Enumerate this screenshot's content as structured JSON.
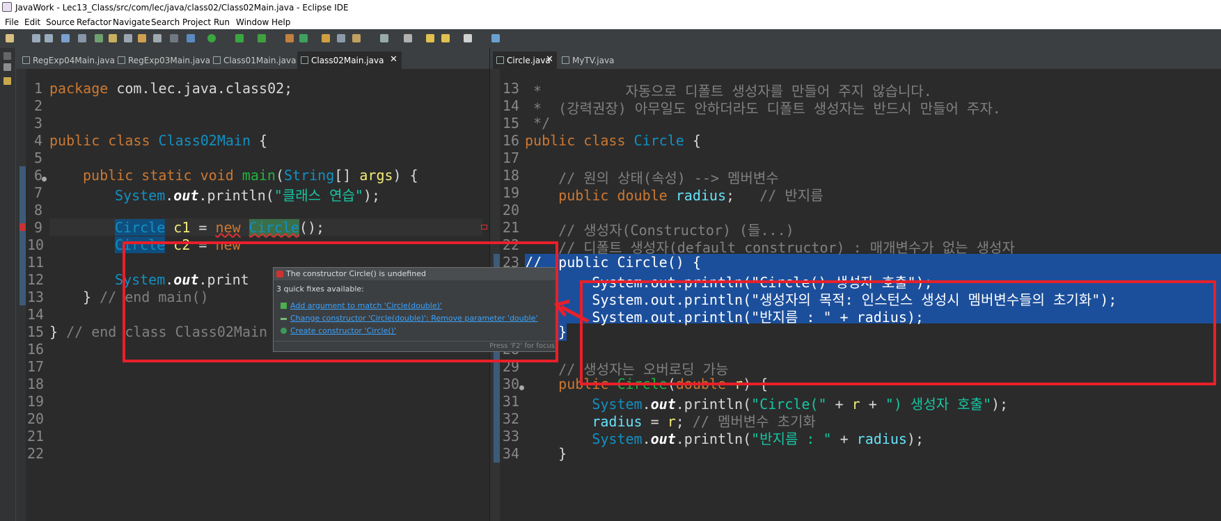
{
  "window": {
    "title": "JavaWork - Lec13_Class/src/com/lec/java/class02/Class02Main.java - Eclipse IDE"
  },
  "menu": [
    "File",
    "Edit",
    "Source",
    "Refactor",
    "Navigate",
    "Search",
    "Project",
    "Run",
    "Window",
    "Help"
  ],
  "left_tabs": [
    "RegExp04Main.java",
    "RegExp03Main.java",
    "Class01Main.java",
    "Class02Main.java"
  ],
  "right_tabs": [
    "Circle.java",
    "MyTV.java"
  ],
  "left_lines": [
    "1",
    "2",
    "3",
    "4",
    "5",
    "6",
    "7",
    "8",
    "9",
    "10",
    "11",
    "12",
    "13",
    "14",
    "15",
    "16",
    "17",
    "18",
    "19",
    "20",
    "21",
    "22"
  ],
  "right_lines": [
    "13",
    "14",
    "15",
    "16",
    "17",
    "18",
    "19",
    "20",
    "21",
    "22",
    "23",
    "24",
    "25",
    "26",
    "27",
    "28",
    "29",
    "30",
    "31",
    "32",
    "33",
    "34"
  ],
  "left_code": {
    "l1_kw": "package",
    "l1_pkg": " com.lec.java.class02;",
    "l4_kw": "public class ",
    "l4_cls": "Class02Main",
    "l4_rest": " {",
    "l6_kw": "public static void ",
    "l6_m": "main",
    "l6_p1": "(",
    "l6_t": "String",
    "l6_p2": "[] ",
    "l6_a": "args",
    "l6_p3": ") {",
    "l7_c": "System",
    "l7_d": ".",
    "l7_o": "out",
    "l7_pr": ".println(",
    "l7_s": "\"클래스 연습\"",
    "l7_e": ");",
    "l9_t": "Circle",
    "l9_v": " c1",
    "l9_eq": " = ",
    "l9_new": "new",
    "l9_sp": " ",
    "l9_c": "Circle",
    "l9_e": "();",
    "l10_t": "Circle",
    "l10_v": " c2",
    "l10_eq": " = ",
    "l10_new": "new",
    "l12_c": "System",
    "l12_d": ".",
    "l12_o": "out",
    "l12_pr": ".print",
    "l13_b": "} ",
    "l13_cm": "// end main()",
    "l15_b": "} ",
    "l15_cm": "// end class Class02Main"
  },
  "right_code": {
    "r13": " *          자동으로 디폴트 생성자를 만들어 주지 않습니다.",
    "r14": " *  (강력권장) 아무일도 안하더라도 디폴트 생성자는 반드시 만들어 주자.",
    "r15": " */",
    "r16_kw": "public class ",
    "r16_cls": "Circle",
    "r16_rest": " {",
    "r18": "    // 원의 상태(속성) --> 멤버변수",
    "r19_kw": "    public double ",
    "r19_f": "radius",
    "r19_e": ";",
    "r19_cm": "   // 반지름",
    "r21": "    // 생성자(Constructor) (들...)",
    "r22": "    // 디폴트 생성자(default constructor) : 매개변수가 없는 생성자",
    "r23": "//  public Circle() {",
    "r24": "//      System.out.println(\"Circle() 생성자 호출\");",
    "r25": "//      System.out.println(\"생성자의 목적: 인스턴스 생성시 멤버변수들의 초기화\");",
    "r26": "//      System.out.println(\"반지름 : \" + radius);",
    "r27": "//  }",
    "r29": "    // 생성자는 오버로딩 가능",
    "r30_kw": "    public ",
    "r30_m": "Circle",
    "r30_p": "(",
    "r30_t": "double ",
    "r30_a": "r",
    "r30_e": ") {",
    "r31_c": "        System",
    "r31_d": ".",
    "r31_o": "out",
    "r31_pr": ".println(",
    "r31_s1": "\"Circle(\"",
    "r31_p": " + ",
    "r31_a": "r",
    "r31_p2": " + ",
    "r31_s2": "\") 생성자 호출\"",
    "r31_e": ");",
    "r32_f": "        radius",
    "r32_eq": " = ",
    "r32_a": "r",
    "r32_e": "; ",
    "r32_cm": "// 멤버변수 초기화",
    "r33_c": "        System",
    "r33_d": ".",
    "r33_o": "out",
    "r33_pr": ".println(",
    "r33_s": "\"반지름 : \"",
    "r33_p": " + ",
    "r33_f": "radius",
    "r33_e": ");",
    "r34": "    }"
  },
  "popup": {
    "title": "The constructor Circle() is undefined",
    "subtitle": "3 quick fixes available:",
    "fixes": [
      "Add argument to match 'Circle(double)'",
      "Change constructor 'Circle(double)': Remove parameter 'double'",
      "Create constructor 'Circle()'"
    ],
    "footer": "Press 'F2' for focus"
  },
  "colors": {
    "annotation": "#e8202a",
    "selection": "#0f4f7f",
    "link": "#3aa3ff"
  }
}
